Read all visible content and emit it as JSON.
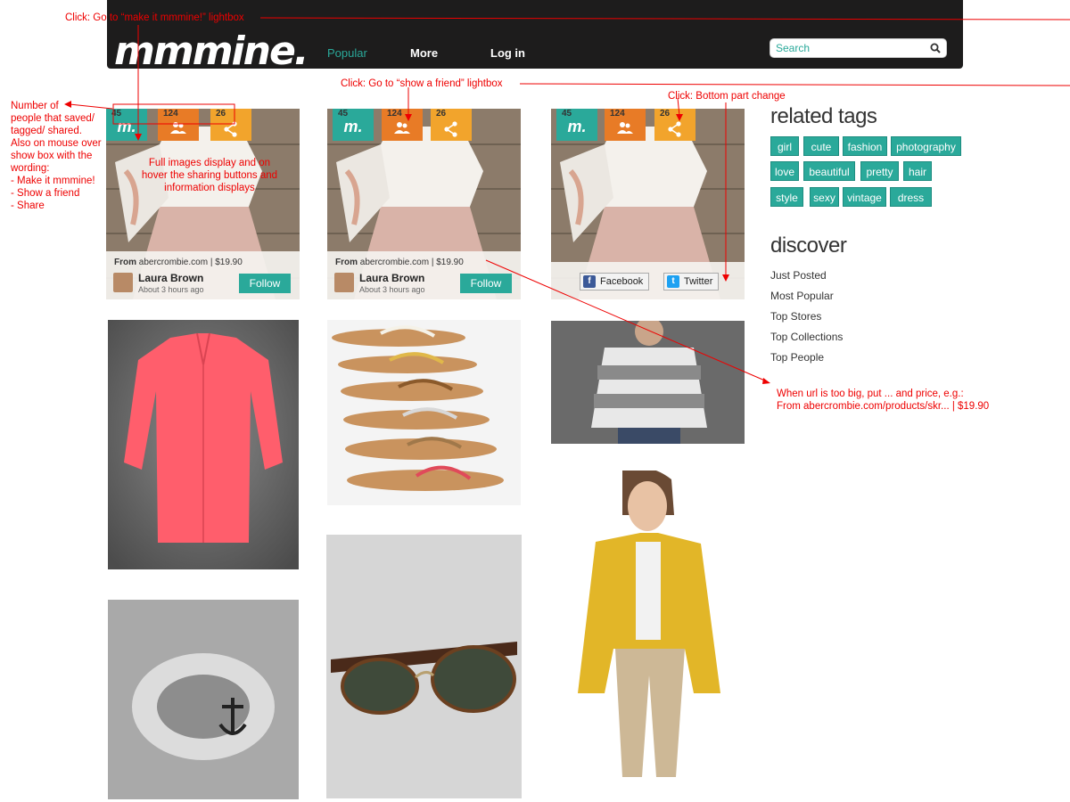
{
  "header": {
    "logo": "mmmine.",
    "nav": [
      "Popular",
      "More",
      "Log in"
    ],
    "search_placeholder": "Search"
  },
  "cards": [
    {
      "saved": "45",
      "friends": "124",
      "shares": "26",
      "from_label": "From",
      "from_site": "abercrombie.com",
      "price": "| $19.90",
      "user": "Laura Brown",
      "time": "About 3 hours ago",
      "follow": "Follow"
    },
    {
      "saved": "45",
      "friends": "124",
      "shares": "26",
      "from_label": "From",
      "from_site": "abercrombie.com",
      "price": "| $19.90",
      "user": "Laura Brown",
      "time": "About 3 hours ago",
      "follow": "Follow"
    },
    {
      "saved": "45",
      "friends": "124",
      "shares": "26",
      "facebook": "Facebook",
      "twitter": "Twitter"
    }
  ],
  "sidebar": {
    "related_title": "related tags",
    "tags": [
      "girl",
      "cute",
      "fashion",
      "photography",
      "love",
      "beautiful",
      "pretty",
      "hair",
      "style",
      "sexy",
      "vintage",
      "dress"
    ],
    "discover_title": "discover",
    "discover_items": [
      "Just Posted",
      "Most Popular",
      "Top Stores",
      "Top Collections",
      "Top People"
    ]
  },
  "annotations": {
    "top": "Click: Go to “make it mmmine!” lightbox",
    "friend": "Click: Go to “show a friend” lightbox",
    "bottom": "Click: Bottom part change",
    "left": [
      "Number of",
      "people that saved/",
      "tagged/ shared.",
      "Also on mouse over",
      "show box with the",
      "wording:",
      "- Make it mmmine!",
      "- Show a friend",
      "- Share"
    ],
    "hover": [
      "Full images display and on",
      "hover the sharing buttons and",
      "information displays"
    ],
    "url": [
      "When url is too big, put ... and price, e.g.:",
      "From abercrombie.com/products/skr...  |  $19.90"
    ]
  },
  "colors": {
    "teal": "#2aa99a",
    "orange": "#e87b26",
    "yellow": "#f2a42c",
    "header": "#1d1c1c",
    "annotation": "#e00000"
  }
}
